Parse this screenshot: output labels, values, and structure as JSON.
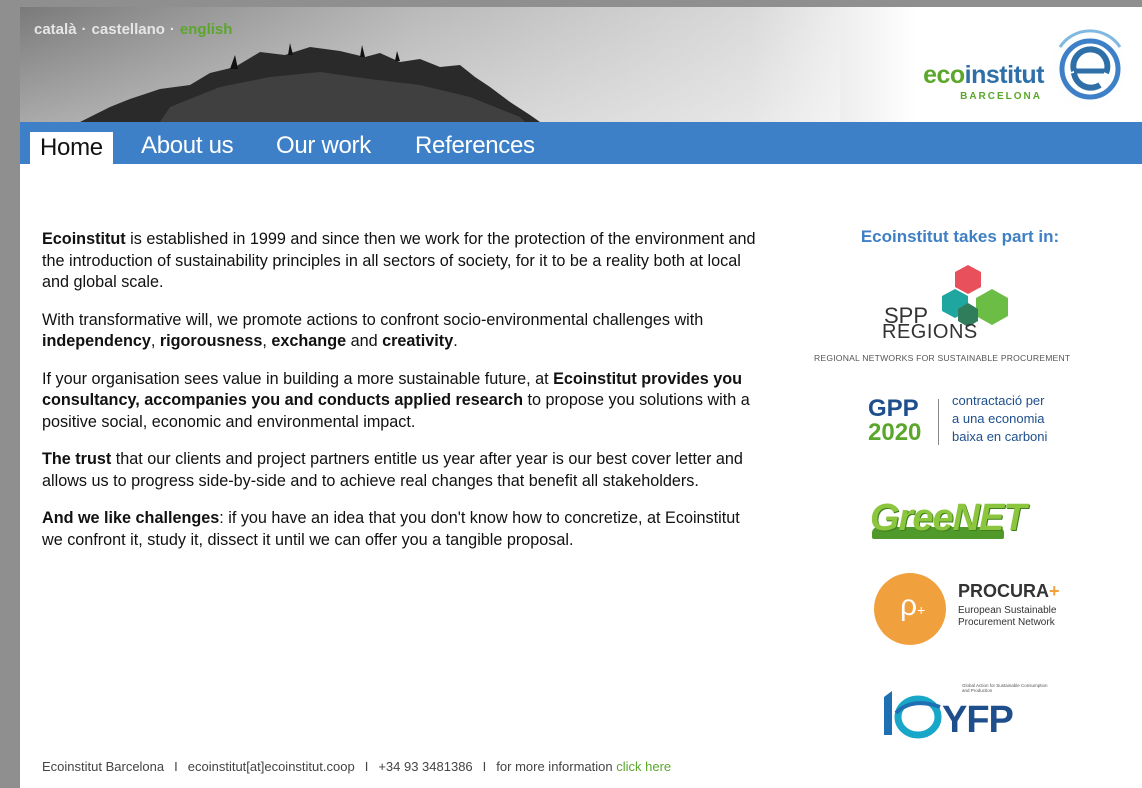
{
  "languages": [
    {
      "label": "català",
      "active": false
    },
    {
      "label": "castellano",
      "active": false
    },
    {
      "label": "english",
      "active": true
    }
  ],
  "logo": {
    "word_green": "eco",
    "word_blue": "institut",
    "city": "BARCELONA"
  },
  "nav": {
    "items": [
      "Home",
      "About us",
      "Our work",
      "References"
    ],
    "active": "Home"
  },
  "content": {
    "p1": {
      "bold": "Ecoinstitut",
      "text": " is established in 1999 and since then we work for the protection of the environment and the introduction of sustainability principles in all sectors of society, for it to be a reality both at local and global scale."
    },
    "p2": {
      "t1": "With transformative will, we promote actions to confront socio-environmental challenges with ",
      "b1": "independency",
      "t2": ", ",
      "b2": "rigorousness",
      "t3": ", ",
      "b3": "exchange",
      "t4": " and ",
      "b4": "creativity",
      "t5": "."
    },
    "p3": {
      "t1": "If your organisation sees value in building a more sustainable future, at ",
      "b1": "Ecoinstitut provides you consultancy, accompanies you and conducts applied research",
      "t2": " to propose you solutions with a positive social, economic and environmental impact."
    },
    "p4": {
      "b1": "The trust",
      "t1": " that our clients and project partners entitle us year after year is our best cover letter and allows us to progress side-by-side and to achieve real changes that benefit all stakeholders."
    },
    "p5": {
      "b1": "And we like challenges",
      "t1": ": if you have an idea that you don't know how to concretize, at Ecoinstitut we confront it, study it, dissect it until we can offer you a tangible proposal."
    }
  },
  "sidebar": {
    "title": "Ecoinstitut takes part in:",
    "spp": {
      "line1": "SPP",
      "line2": "REGIONS",
      "tagline": "REGIONAL NETWORKS FOR SUSTAINABLE PROCUREMENT"
    },
    "gpp": {
      "line1": "GPP",
      "line2": "2020",
      "desc1": "contractació per",
      "desc2": "a una economia",
      "desc3": "baixa en carboni"
    },
    "greenet": {
      "label": "GreeNET"
    },
    "procura": {
      "name": "PROCURA",
      "plus": "+",
      "sub1": "European Sustainable",
      "sub2": "Procurement Network"
    },
    "tenyfp": {
      "tiny": "Global Action for Sustainable Consumption and Production",
      "label": "YFP"
    }
  },
  "footer": {
    "org": "Ecoinstitut Barcelona",
    "email": "ecoinstitut[at]ecoinstitut.coop",
    "phone": "+34 93 3481386",
    "more": "for more information",
    "link": "click here",
    "sep": "I"
  },
  "colors": {
    "nav": "#3e80c7",
    "green": "#5aa72c",
    "blue": "#2e6fa8"
  }
}
